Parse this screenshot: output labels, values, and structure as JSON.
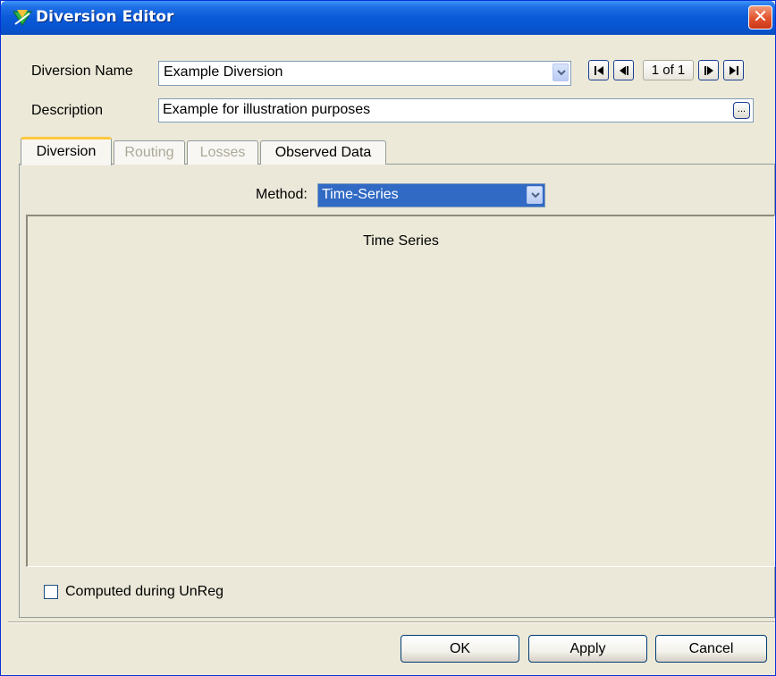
{
  "window": {
    "title": "Diversion Editor",
    "close_glyph": "✕"
  },
  "form": {
    "name_label": "Diversion Name",
    "name_value": "Example Diversion",
    "description_label": "Description",
    "description_value": "Example for illustration purposes",
    "ellipsis_label": "...",
    "record_counter": "1 of 1"
  },
  "tabs": [
    {
      "label": "Diversion",
      "state": "active"
    },
    {
      "label": "Routing",
      "state": "disabled"
    },
    {
      "label": "Losses",
      "state": "disabled"
    },
    {
      "label": "Observed Data",
      "state": "enabled"
    }
  ],
  "diversion_tab": {
    "method_label": "Method:",
    "method_value": "Time-Series",
    "panel_title": "Time Series",
    "computed_checkbox_label": "Computed during UnReg",
    "computed_checked": false
  },
  "buttons": {
    "ok": "OK",
    "apply": "Apply",
    "cancel": "Cancel"
  },
  "icons": {
    "app": "diversion-app-icon",
    "first": "first-record-icon",
    "prev": "previous-record-icon",
    "next": "next-record-icon",
    "last": "last-record-icon"
  },
  "colors": {
    "title_bar": "#0a5ad8",
    "selection": "#316ac5",
    "active_tab_accent": "#ffc83c",
    "close": "#e2532c"
  }
}
